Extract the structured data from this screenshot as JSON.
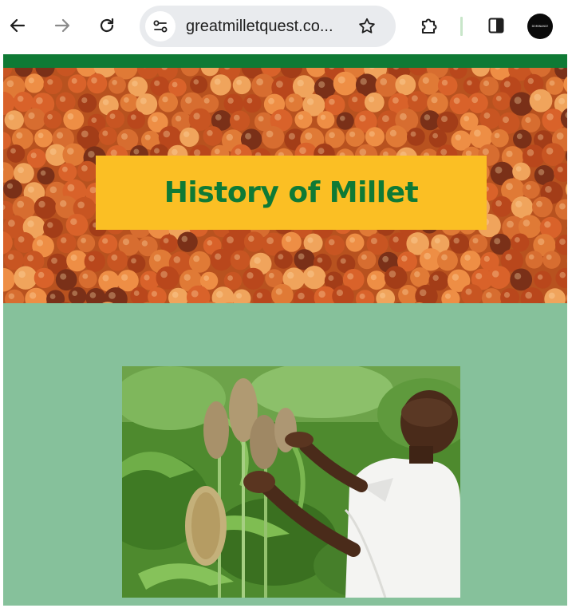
{
  "browser": {
    "url": "greatmilletquest.co...",
    "profile_label": "DOMINANCE"
  },
  "page": {
    "title": "History of Millet"
  },
  "colors": {
    "accent_green": "#0f7a35",
    "banner_yellow": "#fbbf24",
    "page_background": "#86c19b"
  },
  "icons": {
    "back": "arrow-left-icon",
    "forward": "arrow-right-icon",
    "reload": "reload-icon",
    "site_info": "tune-icon",
    "bookmark": "star-icon",
    "extensions": "puzzle-icon",
    "side_panel": "side-panel-icon"
  }
}
